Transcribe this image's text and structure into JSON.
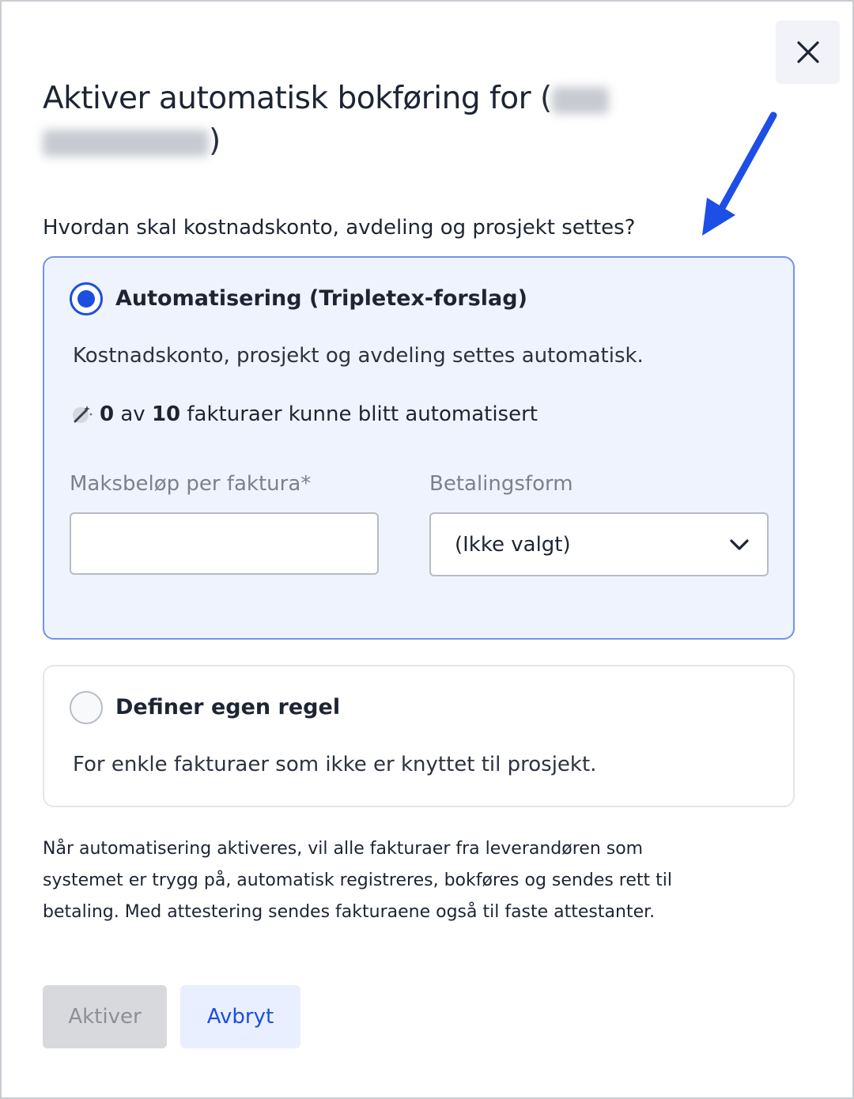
{
  "dialog": {
    "title_prefix": "Aktiver automatisk bokføring for (",
    "title_suffix": ")",
    "question": "Hvordan skal kostnadskonto, avdeling og prosjekt settes?"
  },
  "option_auto": {
    "title": "Automatisering (Tripletex-forslag)",
    "description": "Kostnadskonto, prosjekt og avdeling settes automatisk.",
    "stat_count": "0",
    "stat_of": "av",
    "stat_total": "10",
    "stat_text": "fakturaer kunne blitt automatisert",
    "selected": true,
    "max_amount_label": "Maksbeløp per faktura*",
    "max_amount_value": "",
    "payment_label": "Betalingsform",
    "payment_value": "(Ikke valgt)"
  },
  "option_own": {
    "title": "Definer egen regel",
    "description": "For enkle fakturaer som ikke er knyttet til prosjekt.",
    "selected": false
  },
  "info_text": "Når automatisering aktiveres, vil alle fakturaer fra leverandøren som systemet er trygg på, automatisk registreres, bokføres og sendes rett til betaling. Med attestering sendes fakturaene også til faste attestanter.",
  "buttons": {
    "activate": "Aktiver",
    "cancel": "Avbryt"
  },
  "colors": {
    "accent": "#1a4fe0",
    "annotation_arrow": "#1d4fe6",
    "selected_card_bg": "#eff3fd",
    "selected_card_border": "#6f94ee"
  },
  "icons": {
    "close": "close-icon",
    "wand": "magic-wand-icon",
    "chevron": "chevron-down-icon",
    "arrow": "annotation-arrow-icon"
  }
}
